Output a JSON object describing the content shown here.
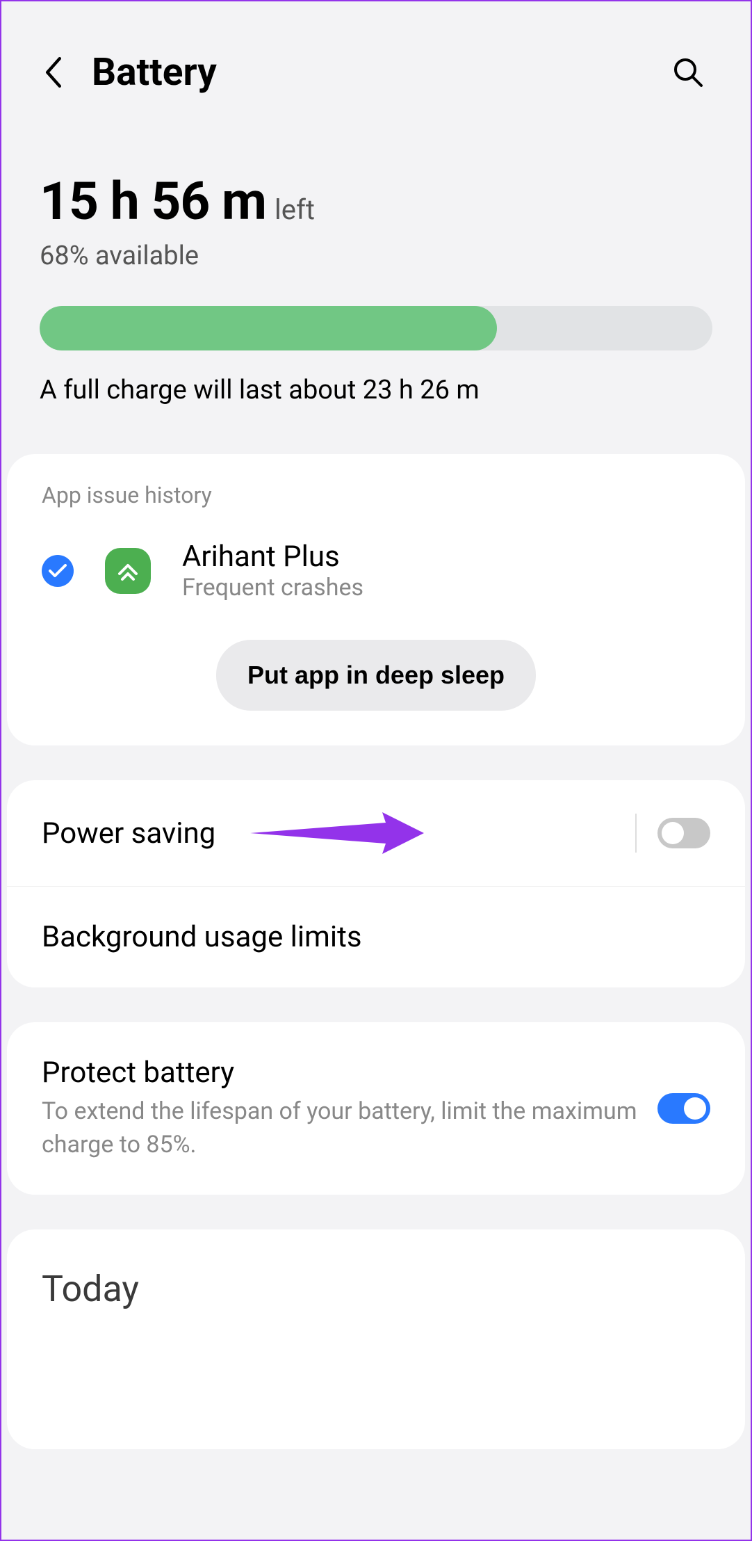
{
  "header": {
    "title": "Battery"
  },
  "summary": {
    "time_remaining": "15 h 56 m",
    "time_suffix": "left",
    "percent_available": "68% available",
    "battery_percent": 68,
    "full_charge_text": "A full charge will last about 23 h 26 m"
  },
  "app_issue": {
    "section_title": "App issue history",
    "app_name": "Arihant Plus",
    "reason": "Frequent crashes",
    "action_button": "Put app in deep sleep"
  },
  "settings": {
    "power_saving": {
      "label": "Power saving",
      "on": false
    },
    "background_limits": {
      "label": "Background usage limits"
    }
  },
  "protect": {
    "title": "Protect battery",
    "desc": "To extend the lifespan of your battery, limit the maximum charge to 85%.",
    "on": true
  },
  "usage": {
    "title": "Today"
  },
  "colors": {
    "progress_fill": "#71c784",
    "accent_blue": "#2979ff",
    "annotation_purple": "#9333ea"
  }
}
